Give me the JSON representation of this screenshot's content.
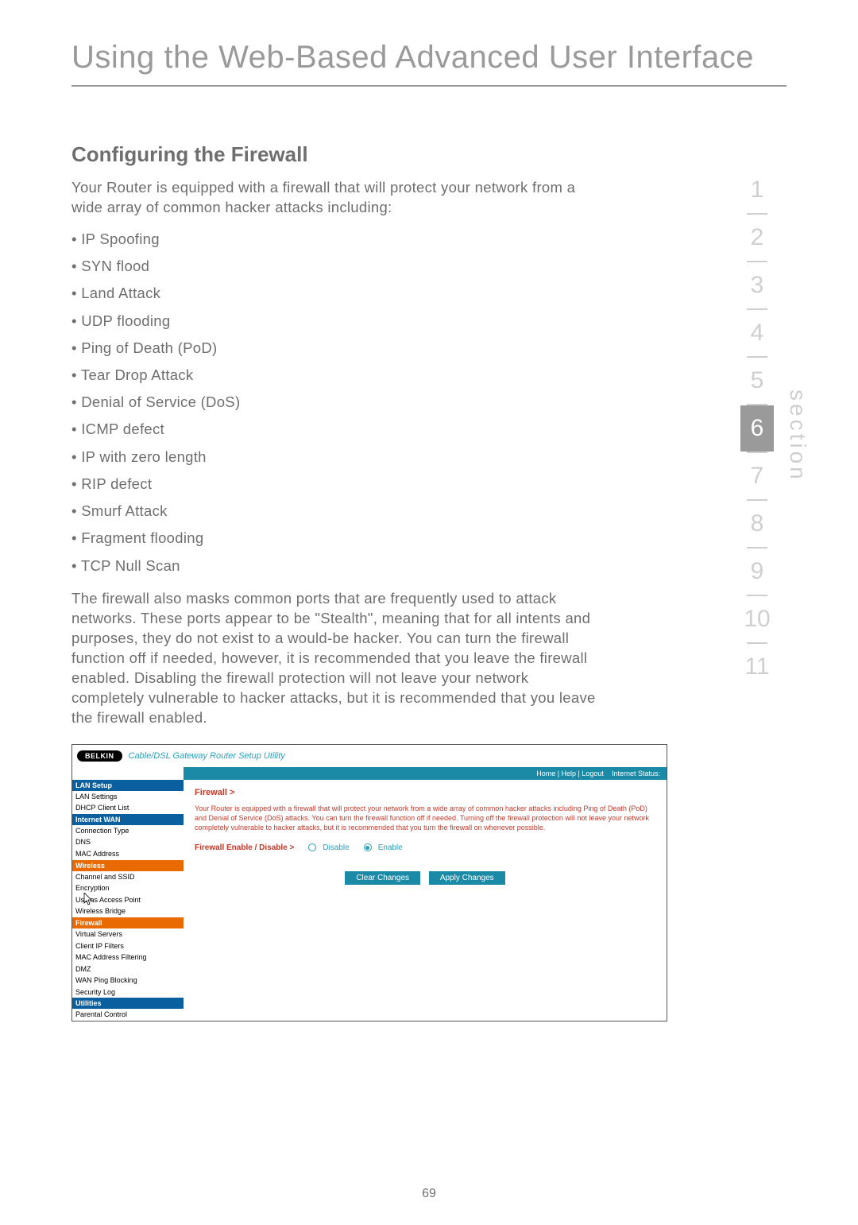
{
  "page": {
    "title": "Using the Web-Based Advanced User Interface",
    "heading": "Configuring the Firewall",
    "intro": "Your Router is equipped with a firewall that will protect your network from a wide array of common hacker attacks including:",
    "attacks": [
      "IP Spoofing",
      "SYN flood",
      "Land Attack",
      "UDP flooding",
      "Ping of Death (PoD)",
      "Tear Drop Attack",
      "Denial of Service (DoS)",
      "ICMP defect",
      "IP with zero length",
      "RIP defect",
      "Smurf Attack",
      "Fragment flooding",
      "TCP Null Scan"
    ],
    "para2": "The firewall also masks common ports that are frequently used to attack networks. These ports appear to be \"Stealth\", meaning that for all intents and purposes, they do not exist to a would-be hacker. You can turn the firewall function off if needed, however, it is recommended that you leave the firewall enabled. Disabling the firewall protection will not leave your network completely vulnerable to hacker attacks, but it is recommended that you leave the firewall enabled.",
    "page_number": "69"
  },
  "sidebar": {
    "items": [
      "1",
      "2",
      "3",
      "4",
      "5",
      "6",
      "7",
      "8",
      "9",
      "10",
      "11"
    ],
    "active_index": 5,
    "label": "section"
  },
  "screenshot": {
    "brand": "BELKIN",
    "subtitle": "Cable/DSL Gateway Router Setup Utility",
    "statusbar": {
      "links": "Home | Help | Logout",
      "status_label": "Internet Status:"
    },
    "nav": {
      "groups": [
        {
          "header": "LAN Setup",
          "items": [
            "LAN Settings",
            "DHCP Client List"
          ],
          "class": ""
        },
        {
          "header": "Internet WAN",
          "items": [
            "Connection Type",
            "DNS",
            "MAC Address"
          ],
          "class": ""
        },
        {
          "header": "Wireless",
          "items": [
            "Channel and SSID",
            "Encryption",
            "Use as Access Point",
            "Wireless Bridge"
          ],
          "class": "orange"
        },
        {
          "header": "Firewall",
          "items": [
            "Virtual Servers",
            "Client IP Filters",
            "MAC Address Filtering",
            "DMZ",
            "WAN Ping Blocking",
            "Security Log"
          ],
          "class": "orange"
        },
        {
          "header": "Utilities",
          "items": [
            "Parental Control"
          ],
          "class": ""
        }
      ]
    },
    "main": {
      "crumb": "Firewall >",
      "desc": "Your Router is equipped with a firewall that will protect your network from a wide array of common hacker attacks including Ping of Death (PoD) and Denial of Service (DoS) attacks. You can turn the firewall function off if needed. Turning off the firewall protection will not leave your network completely vulnerable to hacker attacks, but it is recommended that you turn the firewall on whenever possible.",
      "toggle_label": "Firewall Enable / Disable >",
      "disable_label": "Disable",
      "enable_label": "Enable",
      "clear_btn": "Clear Changes",
      "apply_btn": "Apply Changes"
    }
  }
}
